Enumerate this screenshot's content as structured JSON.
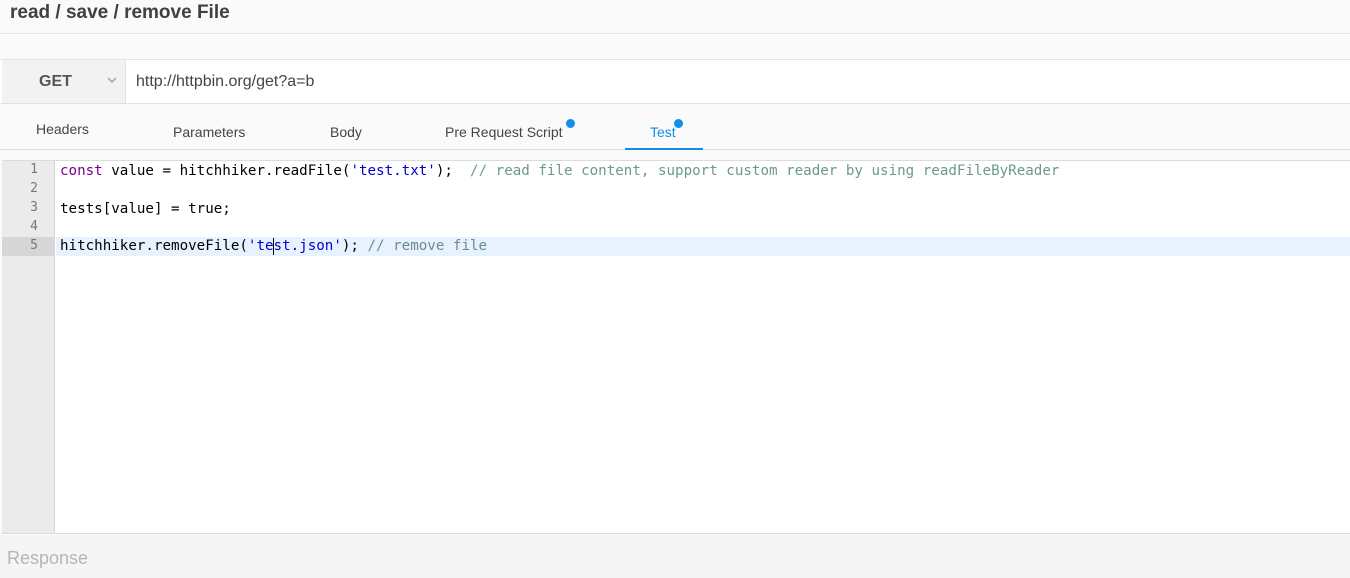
{
  "title": "read / save / remove File",
  "request": {
    "method": "GET",
    "url": "http://httpbin.org/get?a=b"
  },
  "tabs": [
    {
      "label": "Headers",
      "active": false,
      "has_dot": false
    },
    {
      "label": "Parameters",
      "active": false,
      "has_dot": false
    },
    {
      "label": "Body",
      "active": false,
      "has_dot": false
    },
    {
      "label": "Pre Request Script",
      "active": false,
      "has_dot": true
    },
    {
      "label": "Test",
      "active": true,
      "has_dot": true
    }
  ],
  "editor": {
    "line_numbers": [
      "1",
      "2",
      "3",
      "4",
      "5"
    ],
    "active_line": 5,
    "lines": {
      "l1": {
        "kw": "const",
        "code": " value = hitchhiker.readFile(",
        "str": "'test.txt'",
        "end": ");  ",
        "comment": "// read file content, support custom reader by using readFileByReader"
      },
      "l3": {
        "code": "tests[value] = true;"
      },
      "l5": {
        "code": "hitchhiker.removeFile(",
        "str_a": "'te",
        "str_b": "st.json'",
        "end": "); ",
        "comment": "// remove file"
      }
    }
  },
  "response": {
    "label": "Response"
  },
  "colors": {
    "accent": "#108ee9",
    "keyword": "#770088",
    "string": "#0000cc",
    "comment": "#6a9a8a",
    "active_line_bg": "#e8f2fe"
  }
}
